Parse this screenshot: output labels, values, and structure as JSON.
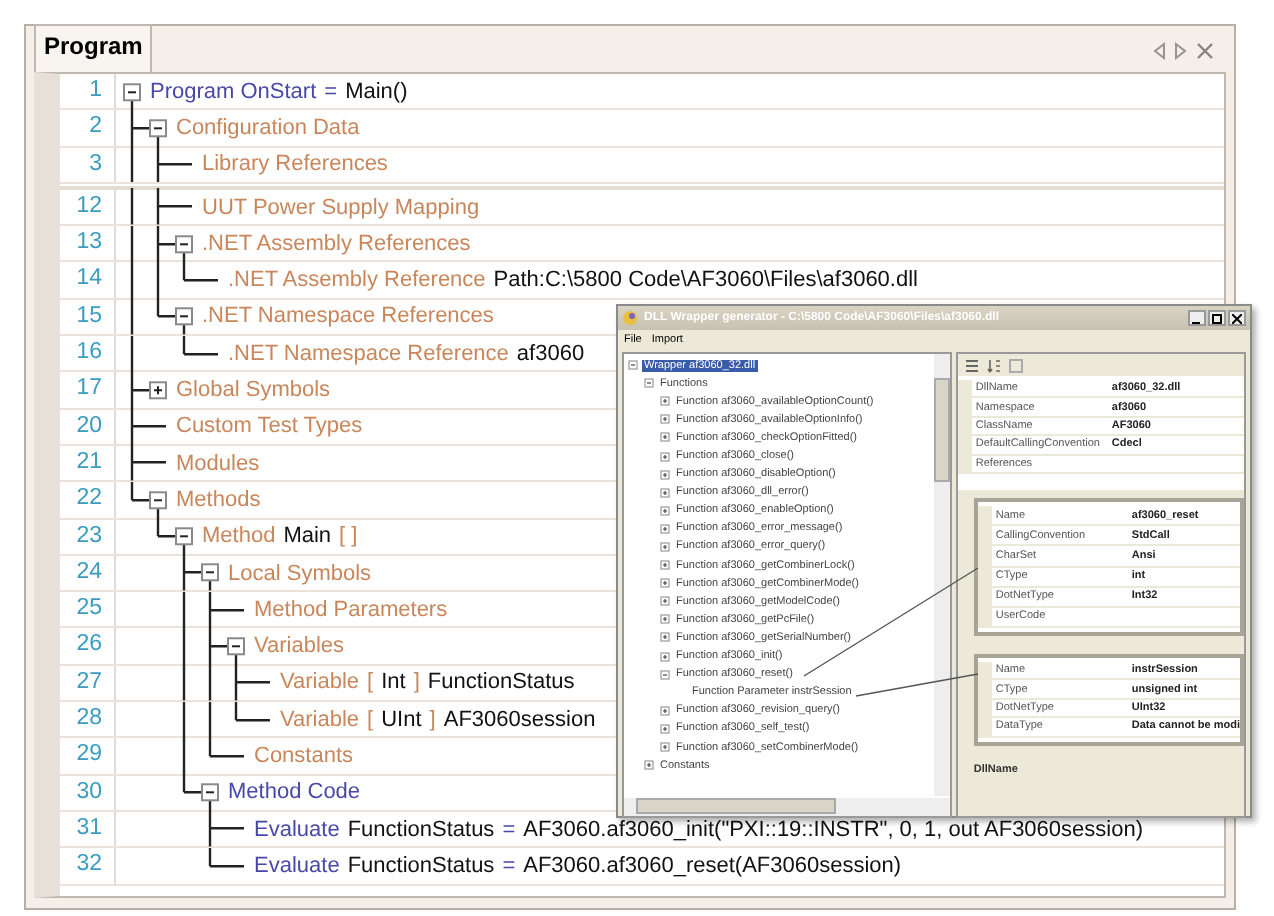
{
  "panel": {
    "tab": {
      "label": "Program",
      "selected": true
    },
    "program": [
      {
        "line": "1",
        "expanded": true,
        "parts": [
          {
            "kind": "statement",
            "text": "Program OnStart"
          },
          {
            "kind": "statement",
            "text": "="
          },
          {
            "kind": "value",
            "text": "Main()"
          }
        ],
        "children": [
          {
            "line": "2",
            "expanded": true,
            "parts": [
              {
                "kind": "keyword",
                "text": "Configuration Data"
              }
            ],
            "children": [
              {
                "line": "3",
                "parts": [
                  {
                    "kind": "keyword",
                    "text": "Library References"
                  }
                ]
              },
              {
                "line": "12",
                "break_before": true,
                "parts": [
                  {
                    "kind": "keyword",
                    "text": "UUT Power Supply Mapping"
                  }
                ]
              },
              {
                "line": "13",
                "expanded": true,
                "parts": [
                  {
                    "kind": "keyword",
                    "text": ".NET Assembly References"
                  }
                ],
                "children": [
                  {
                    "line": "14",
                    "parts": [
                      {
                        "kind": "keyword",
                        "text": ".NET Assembly Reference"
                      },
                      {
                        "kind": "value",
                        "text": "Path:C:\\5800 Code\\AF3060\\Files\\af3060.dll"
                      }
                    ]
                  }
                ]
              },
              {
                "line": "15",
                "expanded": true,
                "parts": [
                  {
                    "kind": "keyword",
                    "text": ".NET Namespace References"
                  }
                ],
                "children": [
                  {
                    "line": "16",
                    "parts": [
                      {
                        "kind": "keyword",
                        "text": ".NET Namespace Reference"
                      },
                      {
                        "kind": "value",
                        "text": "af3060"
                      }
                    ]
                  }
                ]
              }
            ]
          },
          {
            "line": "17",
            "expanded": false,
            "parts": [
              {
                "kind": "keyword",
                "text": "Global Symbols"
              }
            ]
          },
          {
            "line": "20",
            "parts": [
              {
                "kind": "keyword",
                "text": "Custom Test Types"
              }
            ]
          },
          {
            "line": "21",
            "parts": [
              {
                "kind": "keyword",
                "text": "Modules"
              }
            ]
          },
          {
            "line": "22",
            "expanded": true,
            "parts": [
              {
                "kind": "keyword",
                "text": "Methods"
              }
            ],
            "children": [
              {
                "line": "23",
                "expanded": true,
                "parts": [
                  {
                    "kind": "keyword",
                    "text": "Method"
                  },
                  {
                    "kind": "value",
                    "text": "Main"
                  },
                  {
                    "kind": "keyword",
                    "text": "[ ]"
                  }
                ],
                "children": [
                  {
                    "line": "24",
                    "expanded": true,
                    "parts": [
                      {
                        "kind": "keyword",
                        "text": "Local Symbols"
                      }
                    ],
                    "children": [
                      {
                        "line": "25",
                        "parts": [
                          {
                            "kind": "keyword",
                            "text": "Method Parameters"
                          }
                        ]
                      },
                      {
                        "line": "26",
                        "expanded": true,
                        "parts": [
                          {
                            "kind": "keyword",
                            "text": "Variables"
                          }
                        ],
                        "children": [
                          {
                            "line": "27",
                            "parts": [
                              {
                                "kind": "keyword",
                                "text": "Variable"
                              },
                              {
                                "kind": "keyword",
                                "text": "["
                              },
                              {
                                "kind": "value",
                                "text": "Int"
                              },
                              {
                                "kind": "keyword",
                                "text": "]"
                              },
                              {
                                "kind": "value",
                                "text": "FunctionStatus"
                              }
                            ]
                          },
                          {
                            "line": "28",
                            "parts": [
                              {
                                "kind": "keyword",
                                "text": "Variable"
                              },
                              {
                                "kind": "keyword",
                                "text": "["
                              },
                              {
                                "kind": "value",
                                "text": "UInt"
                              },
                              {
                                "kind": "keyword",
                                "text": "]"
                              },
                              {
                                "kind": "value",
                                "text": "AF3060session"
                              }
                            ]
                          }
                        ]
                      },
                      {
                        "line": "29",
                        "parts": [
                          {
                            "kind": "keyword",
                            "text": "Constants"
                          }
                        ]
                      }
                    ]
                  },
                  {
                    "line": "30",
                    "expanded": true,
                    "parts": [
                      {
                        "kind": "statement",
                        "text": "Method Code"
                      }
                    ],
                    "children": [
                      {
                        "line": "31",
                        "parts": [
                          {
                            "kind": "statement",
                            "text": "Evaluate"
                          },
                          {
                            "kind": "value",
                            "text": "FunctionStatus"
                          },
                          {
                            "kind": "statement",
                            "text": "="
                          },
                          {
                            "kind": "value",
                            "text": "AF3060.af3060_init(\"PXI::19::INSTR\", 0, 1, out AF3060session)"
                          }
                        ]
                      },
                      {
                        "line": "32",
                        "parts": [
                          {
                            "kind": "statement",
                            "text": "Evaluate"
                          },
                          {
                            "kind": "value",
                            "text": "FunctionStatus"
                          },
                          {
                            "kind": "statement",
                            "text": "="
                          },
                          {
                            "kind": "value",
                            "text": "AF3060.af3060_reset(AF3060session)"
                          }
                        ]
                      }
                    ]
                  }
                ]
              }
            ]
          }
        ]
      }
    ]
  },
  "inset_window": {
    "title": "DLL Wrapper generator - C:\\5800 Code\\AF3060\\Files\\af3060.dll",
    "menu": [
      "File",
      "Import"
    ],
    "tree": [
      {
        "label": "Wrapper af3060_32.dll",
        "selected": true,
        "expanded": true,
        "children": [
          {
            "label": "Functions",
            "selected": false,
            "expanded": true,
            "children": [
              {
                "label": "Function af3060_availableOptionCount()",
                "selected": false,
                "expanded": false
              },
              {
                "label": "Function af3060_availableOptionInfo()",
                "selected": false,
                "expanded": false
              },
              {
                "label": "Function af3060_checkOptionFitted()",
                "selected": false,
                "expanded": false
              },
              {
                "label": "Function af3060_close()",
                "selected": false,
                "expanded": false
              },
              {
                "label": "Function af3060_disableOption()",
                "selected": false,
                "expanded": false
              },
              {
                "label": "Function af3060_dll_error()",
                "selected": false,
                "expanded": false
              },
              {
                "label": "Function af3060_enableOption()",
                "selected": false,
                "expanded": false
              },
              {
                "label": "Function af3060_error_message()",
                "selected": false,
                "expanded": false
              },
              {
                "label": "Function af3060_error_query()",
                "selected": false,
                "expanded": false
              },
              {
                "label": "Function af3060_getCombinerLock()",
                "selected": false,
                "expanded": false
              },
              {
                "label": "Function af3060_getCombinerMode()",
                "selected": false,
                "expanded": false
              },
              {
                "label": "Function af3060_getModelCode()",
                "selected": false,
                "expanded": false
              },
              {
                "label": "Function af3060_getPcFile()",
                "selected": false,
                "expanded": false
              },
              {
                "label": "Function af3060_getSerialNumber()",
                "selected": false,
                "expanded": false
              },
              {
                "label": "Function af3060_init()",
                "selected": false,
                "expanded": false
              },
              {
                "label": "Function af3060_reset()",
                "selected": false,
                "expanded": true,
                "children": [
                  {
                    "label": "Function Parameter instrSession",
                    "selected": false
                  }
                ]
              },
              {
                "label": "Function af3060_revision_query()",
                "selected": false,
                "expanded": false
              },
              {
                "label": "Function af3060_self_test()",
                "selected": false,
                "expanded": false
              },
              {
                "label": "Function af3060_setCombinerMode()",
                "selected": false,
                "expanded": false
              }
            ]
          },
          {
            "label": "Constants",
            "selected": false,
            "expanded": false
          }
        ]
      }
    ],
    "properties": [
      {
        "name": "DllName",
        "value": "af3060_32.dll"
      },
      {
        "name": "Namespace",
        "value": "af3060"
      },
      {
        "name": "ClassName",
        "value": "AF3060"
      },
      {
        "name": "DefaultCallingConvention",
        "value": "Cdecl"
      },
      {
        "name": "References"
      }
    ],
    "function_details": [
      {
        "name": "Name",
        "value": "af3060_reset"
      },
      {
        "name": "CallingConvention",
        "value": "StdCall"
      },
      {
        "name": "CharSet",
        "value": "Ansi"
      },
      {
        "name": "CType",
        "value": "int"
      },
      {
        "name": "DotNetType",
        "value": "Int32"
      },
      {
        "name": "UserCode"
      }
    ],
    "parameter_details": [
      {
        "name": "Name",
        "value": "instrSession"
      },
      {
        "name": "CType",
        "value": "unsigned int"
      },
      {
        "name": "DotNetType",
        "value": "UInt32"
      },
      {
        "name": "DataType",
        "value": "Data cannot be modi"
      }
    ],
    "description_title": "DllName"
  }
}
